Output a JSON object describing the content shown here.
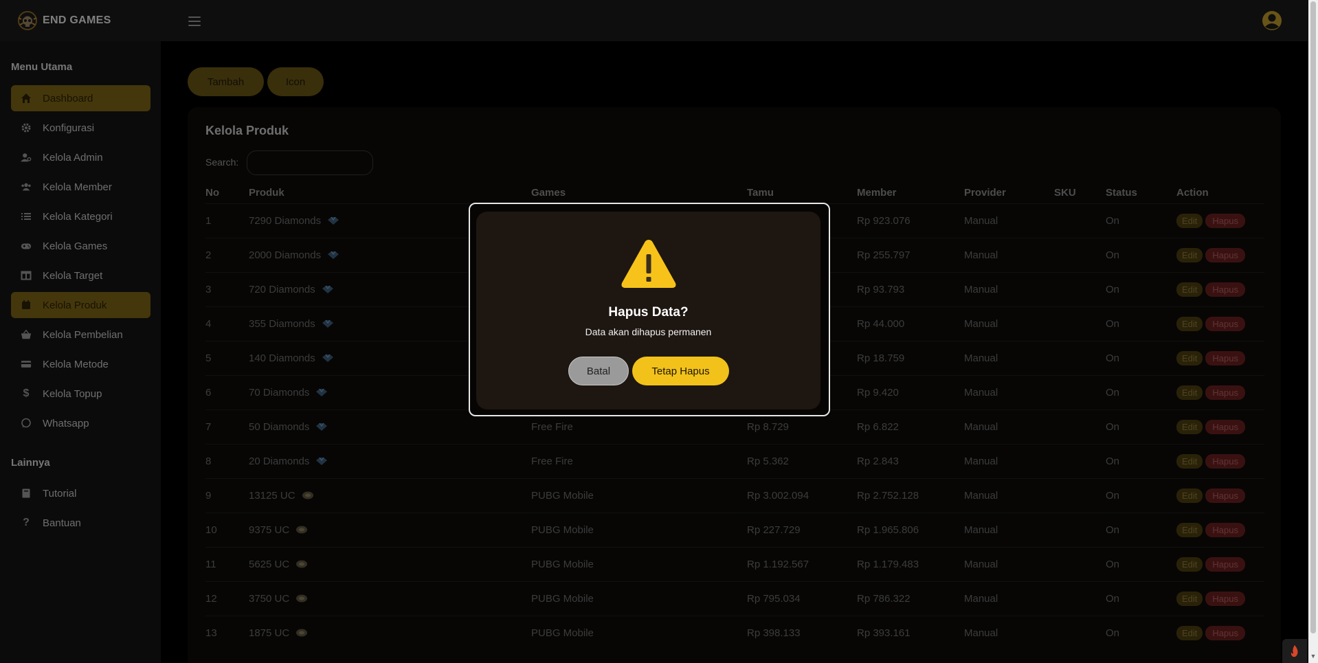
{
  "brand": {
    "name": "END GAMES"
  },
  "sidebar": {
    "main_heading": "Menu Utama",
    "other_heading": "Lainnya",
    "items": [
      {
        "label": "Dashboard",
        "icon": "home-icon",
        "active": true
      },
      {
        "label": "Konfigurasi",
        "icon": "gear-icon",
        "active": false
      },
      {
        "label": "Kelola Admin",
        "icon": "user-cog-icon",
        "active": false
      },
      {
        "label": "Kelola Member",
        "icon": "users-icon",
        "active": false
      },
      {
        "label": "Kelola Kategori",
        "icon": "list-icon",
        "active": false
      },
      {
        "label": "Kelola Games",
        "icon": "gamepad-icon",
        "active": false
      },
      {
        "label": "Kelola Target",
        "icon": "columns-icon",
        "active": false
      },
      {
        "label": "Kelola Produk",
        "icon": "calendar-icon",
        "active": true
      },
      {
        "label": "Kelola Pembelian",
        "icon": "basket-icon",
        "active": false
      },
      {
        "label": "Kelola Metode",
        "icon": "credit-card-icon",
        "active": false
      },
      {
        "label": "Kelola Topup",
        "icon": "dollar-icon",
        "active": false
      },
      {
        "label": "Whatsapp",
        "icon": "whatsapp-icon",
        "active": false
      }
    ],
    "other_items": [
      {
        "label": "Tutorial",
        "icon": "book-icon"
      },
      {
        "label": "Bantuan",
        "icon": "question-icon"
      }
    ]
  },
  "toolbar": {
    "add_label": "Tambah",
    "icon_label": "Icon"
  },
  "card": {
    "title": "Kelola Produk",
    "search_label": "Search:",
    "search_value": ""
  },
  "table": {
    "columns": [
      "No",
      "Produk",
      "Games",
      "Tamu",
      "Member",
      "Provider",
      "SKU",
      "Status",
      "Action"
    ],
    "edit_label": "Edit",
    "delete_label": "Hapus",
    "rows": [
      {
        "no": "1",
        "produk": "7290 Diamonds",
        "icon": "diamond-icon",
        "games": "",
        "tamu": "",
        "member": "Rp 923.076",
        "provider": "Manual",
        "sku": "",
        "status": "On"
      },
      {
        "no": "2",
        "produk": "2000 Diamonds",
        "icon": "diamond-icon",
        "games": "",
        "tamu": "",
        "member": "Rp 255.797",
        "provider": "Manual",
        "sku": "",
        "status": "On"
      },
      {
        "no": "3",
        "produk": "720 Diamonds",
        "icon": "diamond-icon",
        "games": "",
        "tamu": "",
        "member": "Rp 93.793",
        "provider": "Manual",
        "sku": "",
        "status": "On"
      },
      {
        "no": "4",
        "produk": "355 Diamonds",
        "icon": "diamond-icon",
        "games": "",
        "tamu": "",
        "member": "Rp 44.000",
        "provider": "Manual",
        "sku": "",
        "status": "On"
      },
      {
        "no": "5",
        "produk": "140 Diamonds",
        "icon": "diamond-icon",
        "games": "",
        "tamu": "",
        "member": "Rp 18.759",
        "provider": "Manual",
        "sku": "",
        "status": "On"
      },
      {
        "no": "6",
        "produk": "70 Diamonds",
        "icon": "diamond-icon",
        "games": "",
        "tamu": "",
        "member": "Rp 9.420",
        "provider": "Manual",
        "sku": "",
        "status": "On"
      },
      {
        "no": "7",
        "produk": "50 Diamonds",
        "icon": "diamond-icon",
        "games": "Free Fire",
        "tamu": "Rp 8.729",
        "member": "Rp 6.822",
        "provider": "Manual",
        "sku": "",
        "status": "On"
      },
      {
        "no": "8",
        "produk": "20 Diamonds",
        "icon": "diamond-icon",
        "games": "Free Fire",
        "tamu": "Rp 5.362",
        "member": "Rp 2.843",
        "provider": "Manual",
        "sku": "",
        "status": "On"
      },
      {
        "no": "9",
        "produk": "13125 UC",
        "icon": "uc-icon",
        "games": "PUBG Mobile",
        "tamu": "Rp 3.002.094",
        "member": "Rp 2.752.128",
        "provider": "Manual",
        "sku": "",
        "status": "On"
      },
      {
        "no": "10",
        "produk": "9375 UC",
        "icon": "uc-icon",
        "games": "PUBG Mobile",
        "tamu": "Rp 227.729",
        "member": "Rp 1.965.806",
        "provider": "Manual",
        "sku": "",
        "status": "On"
      },
      {
        "no": "11",
        "produk": "5625 UC",
        "icon": "uc-icon",
        "games": "PUBG Mobile",
        "tamu": "Rp 1.192.567",
        "member": "Rp 1.179.483",
        "provider": "Manual",
        "sku": "",
        "status": "On"
      },
      {
        "no": "12",
        "produk": "3750 UC",
        "icon": "uc-icon",
        "games": "PUBG Mobile",
        "tamu": "Rp 795.034",
        "member": "Rp 786.322",
        "provider": "Manual",
        "sku": "",
        "status": "On"
      },
      {
        "no": "13",
        "produk": "1875 UC",
        "icon": "uc-icon",
        "games": "PUBG Mobile",
        "tamu": "Rp 398.133",
        "member": "Rp 393.161",
        "provider": "Manual",
        "sku": "",
        "status": "On"
      }
    ]
  },
  "dialog": {
    "title": "Hapus Data?",
    "text": "Data akan dihapus permanen",
    "cancel_label": "Batal",
    "confirm_label": "Tetap Hapus",
    "icon": "warning-icon"
  },
  "colors": {
    "accent": "#f2c21b",
    "sidebar_active": "#7c6515",
    "danger": "#6a1f1f"
  }
}
